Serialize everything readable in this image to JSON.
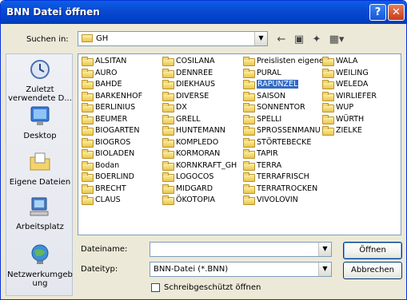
{
  "window": {
    "title": "BNN Datei öffnen",
    "help_label": "?",
    "close_label": "✕"
  },
  "lookin": {
    "label": "Suchen in:",
    "value": "GH"
  },
  "places": [
    {
      "label": "Zuletzt verwendete D...",
      "icon": "recent-icon"
    },
    {
      "label": "Desktop",
      "icon": "desktop-icon"
    },
    {
      "label": "Eigene Dateien",
      "icon": "my-documents-icon"
    },
    {
      "label": "Arbeitsplatz",
      "icon": "my-computer-icon"
    },
    {
      "label": "Netzwerkumgeb ung",
      "icon": "network-icon"
    }
  ],
  "folders": {
    "col1": [
      "ALSITAN",
      "AURO",
      "BAHDE",
      "BARKENHOF",
      "BERLINIUS",
      "BEUMER",
      "BIOGARTEN",
      "BIOGROS",
      "BIOLADEN",
      "Bodan",
      "BOERLIND",
      "BRECHT",
      "CLAUS"
    ],
    "col2": [
      "COSILANA",
      "DENNREE",
      "DIEKHAUS",
      "DIVERSE",
      "DX",
      "GRELL",
      "HUNTEMANN",
      "KOMPLEDO",
      "KORMORAN",
      "KORNKRAFT_GH",
      "LOGOCOS",
      "MIDGARD",
      "ÖKOTOPIA"
    ],
    "col3": [
      "Preislisten eigene",
      "PURAL",
      "RAPUNZEL",
      "SAISON",
      "SONNENTOR",
      "SPELLI",
      "SPROSSENMANU",
      "STÖRTEBECKE",
      "TAPIR",
      "TERRA",
      "TERRAFRISCH",
      "TERRATROCKEN",
      "VIVOLOVIN"
    ],
    "col4": [
      "WALA",
      "WEILING",
      "WELEDA",
      "WIRLIEFER",
      "WUP",
      "WÜRTH",
      "ZIELKE"
    ]
  },
  "selected_folder": "RAPUNZEL",
  "filename": {
    "label": "Dateiname:",
    "value": ""
  },
  "filetype": {
    "label": "Dateityp:",
    "value": "BNN-Datei (*.BNN)"
  },
  "readonly_checkbox": {
    "label": "Schreibgeschützt öffnen",
    "checked": false
  },
  "buttons": {
    "open": "Öffnen",
    "cancel": "Abbrechen"
  },
  "colors": {
    "titlebar": "#0a4bd1",
    "selection": "#316ac5",
    "dialog_bg": "#ece9d8"
  }
}
